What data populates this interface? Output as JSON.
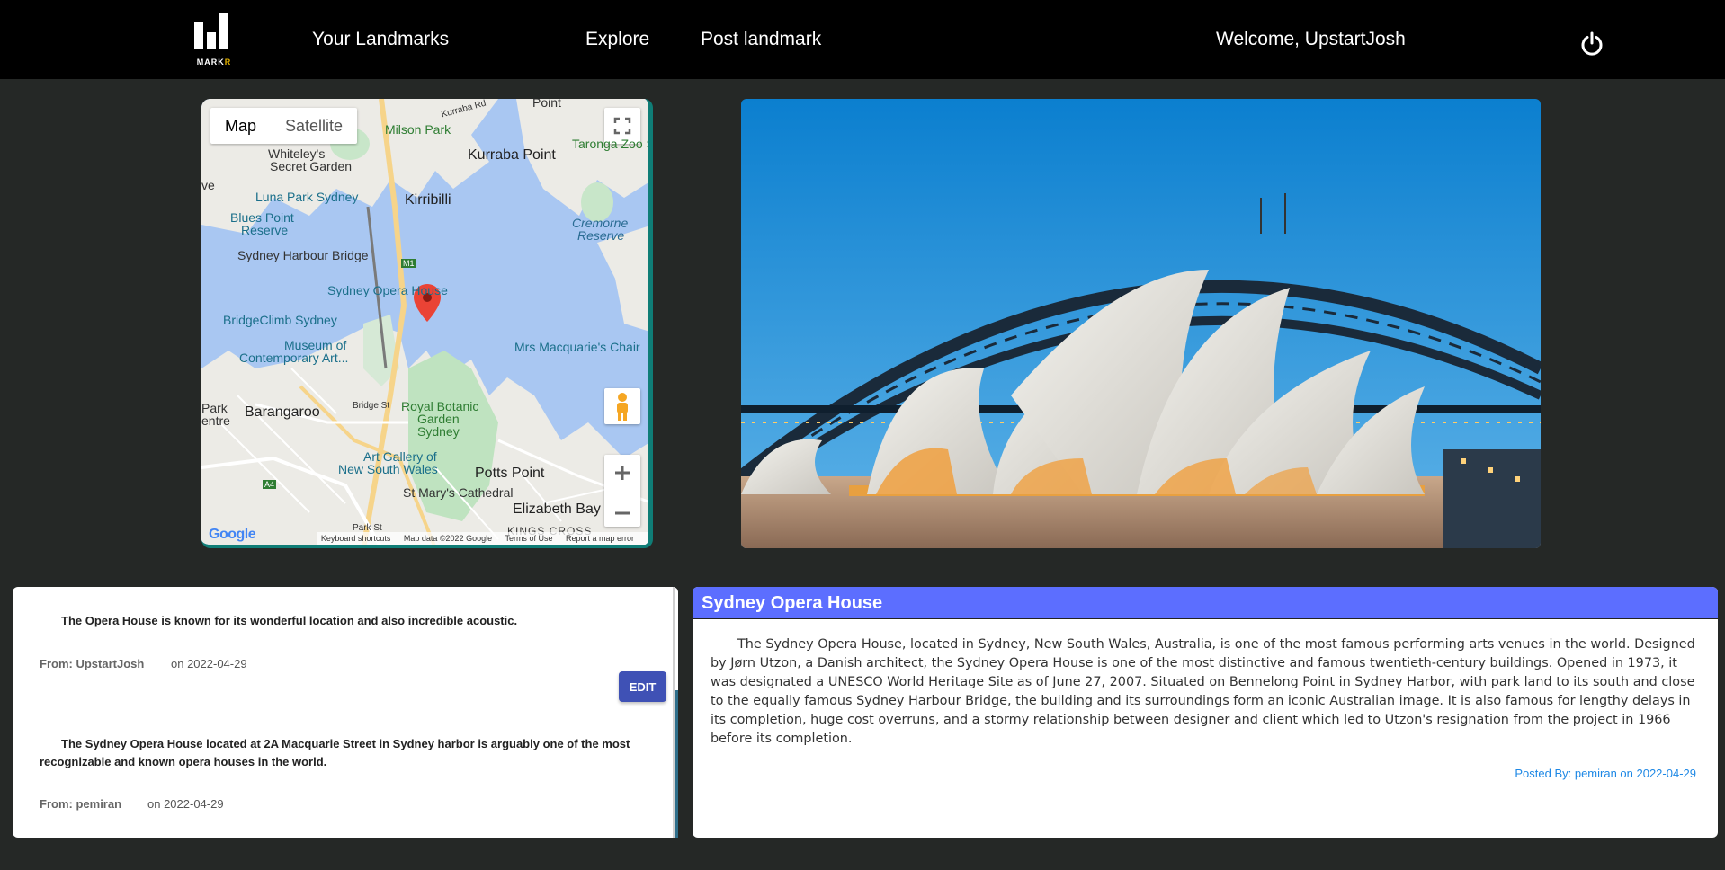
{
  "nav": {
    "logo_text": "MARK",
    "logo_text_accent": "R",
    "links": [
      "Your Landmarks",
      "Explore",
      "Post landmark"
    ],
    "welcome": "Welcome, UpstartJosh"
  },
  "map": {
    "type_options": [
      "Map",
      "Satellite"
    ],
    "labels": [
      "Point",
      "Kurraba Rd",
      "Milson Park",
      "Whiteley's",
      "Secret Garden",
      "Taronga Zoo S",
      "Kurraba Point",
      "Kirribilli",
      "ve",
      "Luna Park Sydney",
      "Blues Point",
      "Reserve",
      "Cremorne",
      "Reserve",
      "Sydney Harbour Bridge",
      "M1",
      "Sydney Opera House",
      "BridgeClimb Sydney",
      "Museum of",
      "Contemporary Art...",
      "Mrs Macquarie's Chair",
      "Park",
      "entre",
      "Barangaroo",
      "Bridge St",
      "Royal Botanic",
      "Garden",
      "Sydney",
      "Art Gallery of",
      "New South Wales",
      "Potts Point",
      "A4",
      "St Mary's Cathedral",
      "Elizabeth Bay",
      "Park St",
      "KINGS CROSS"
    ],
    "logo": "Google",
    "footer": [
      "Keyboard shortcuts",
      "Map data ©2022 Google",
      "Terms of Use",
      "Report a map error"
    ]
  },
  "comments": [
    {
      "text": "The Opera House is known for its wonderful location and also incredible acoustic.",
      "from_label": "From:",
      "author": "UpstartJosh",
      "date": "on 2022-04-29",
      "editable": true
    },
    {
      "text": "The Sydney Opera House located at 2A Macquarie Street in Sydney harbor is arguably one of the most recognizable and known opera houses in the world.",
      "from_label": "From:",
      "author": "pemiran",
      "date": "on 2022-04-29",
      "editable": false
    }
  ],
  "edit_label": "EDIT",
  "landmark": {
    "title": "Sydney Opera House",
    "description": "The Sydney Opera House, located in Sydney, New South Wales, Australia, is one of the most famous performing arts venues in the world. Designed by Jørn Utzon, a Danish architect, the Sydney Opera House is one of the most distinctive and famous twentieth-century buildings. Opened in 1973, it was designated a UNESCO World Heritage Site as of June 27, 2007. Situated on Bennelong Point in Sydney Harbor, with park land to its south and close to the equally famous Sydney Harbour Bridge, the building and its surroundings form an iconic Australian image. It is also famous for lengthy delays in its completion, huge cost overruns, and a stormy relationship between designer and client which led to Utzon's resignation from the project in 1966 before its completion.",
    "posted_by": "Posted By: pemiran on 2022-04-29"
  },
  "colors": {
    "nav_bg": "#000000",
    "page_bg": "#252826",
    "header_accent": "#5c6eff",
    "edit_button": "#3f51b5",
    "posted_link": "#1e88e5"
  },
  "icons": [
    "power-icon",
    "fullscreen-icon",
    "pegman-icon",
    "zoom-in-icon",
    "zoom-out-icon",
    "map-pin-icon"
  ]
}
